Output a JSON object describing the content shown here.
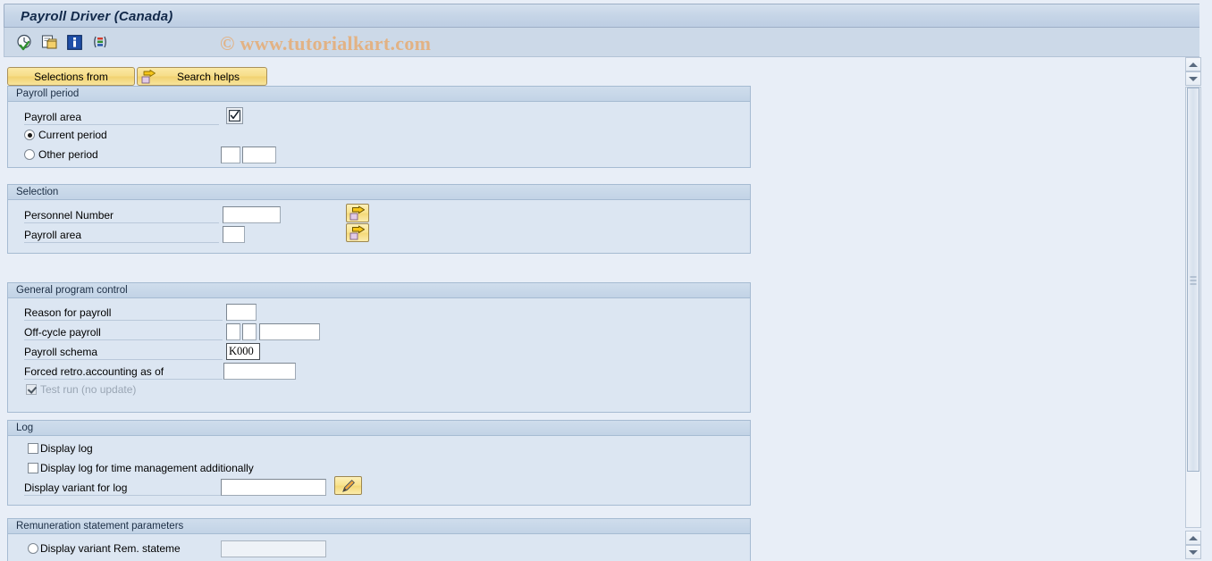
{
  "window": {
    "title": "Payroll Driver (Canada)",
    "watermark": "© www.tutorialkart.com"
  },
  "toolbar": {
    "icons": [
      {
        "name": "execute-clock-icon",
        "title": "Execute"
      },
      {
        "name": "copy-note-icon",
        "title": "Get Variant"
      },
      {
        "name": "info-icon",
        "title": "Information"
      },
      {
        "name": "color-bars-icon",
        "title": "Display"
      }
    ]
  },
  "action_buttons": {
    "selections_from": "Selections from",
    "search_helps": "Search helps"
  },
  "groups": {
    "payroll_period": {
      "title": "Payroll period",
      "payroll_area_label": "Payroll area",
      "payroll_area_value": "",
      "current_period_label": "Current period",
      "current_period_selected": true,
      "other_period_label": "Other period",
      "other_period_selected": false,
      "other_period_value_1": "",
      "other_period_value_2": ""
    },
    "selection": {
      "title": "Selection",
      "personnel_number_label": "Personnel Number",
      "personnel_number_value": "",
      "payroll_area_label": "Payroll area",
      "payroll_area_value": ""
    },
    "general_program_control": {
      "title": "General program control",
      "reason_label": "Reason for payroll",
      "reason_value": "",
      "offcycle_label": "Off-cycle payroll",
      "offcycle_value_1": "",
      "offcycle_value_2": "",
      "offcycle_value_3": "",
      "schema_label": "Payroll schema",
      "schema_value": "K000",
      "forced_retro_label": "Forced retro.accounting as of",
      "forced_retro_value": "",
      "test_run_label": "Test run (no update)",
      "test_run_checked": true
    },
    "log": {
      "title": "Log",
      "display_log_label": "Display log",
      "display_log_checked": false,
      "display_log_time_label": "Display log for time management additionally",
      "display_log_time_checked": false,
      "display_variant_label": "Display variant for log",
      "display_variant_value": ""
    },
    "remuneration": {
      "title": "Remuneration statement parameters",
      "display_variant_rem_label": "Display variant Rem. stateme",
      "display_variant_rem_selected": false,
      "display_variant_rem_value": ""
    }
  },
  "colors": {
    "background": "#e8eef7",
    "group_bg": "#dce6f2",
    "group_border": "#a6bbd2",
    "title_text": "#12294a",
    "button_yellow": "#f6dd89",
    "watermark": "#e4b07f"
  }
}
